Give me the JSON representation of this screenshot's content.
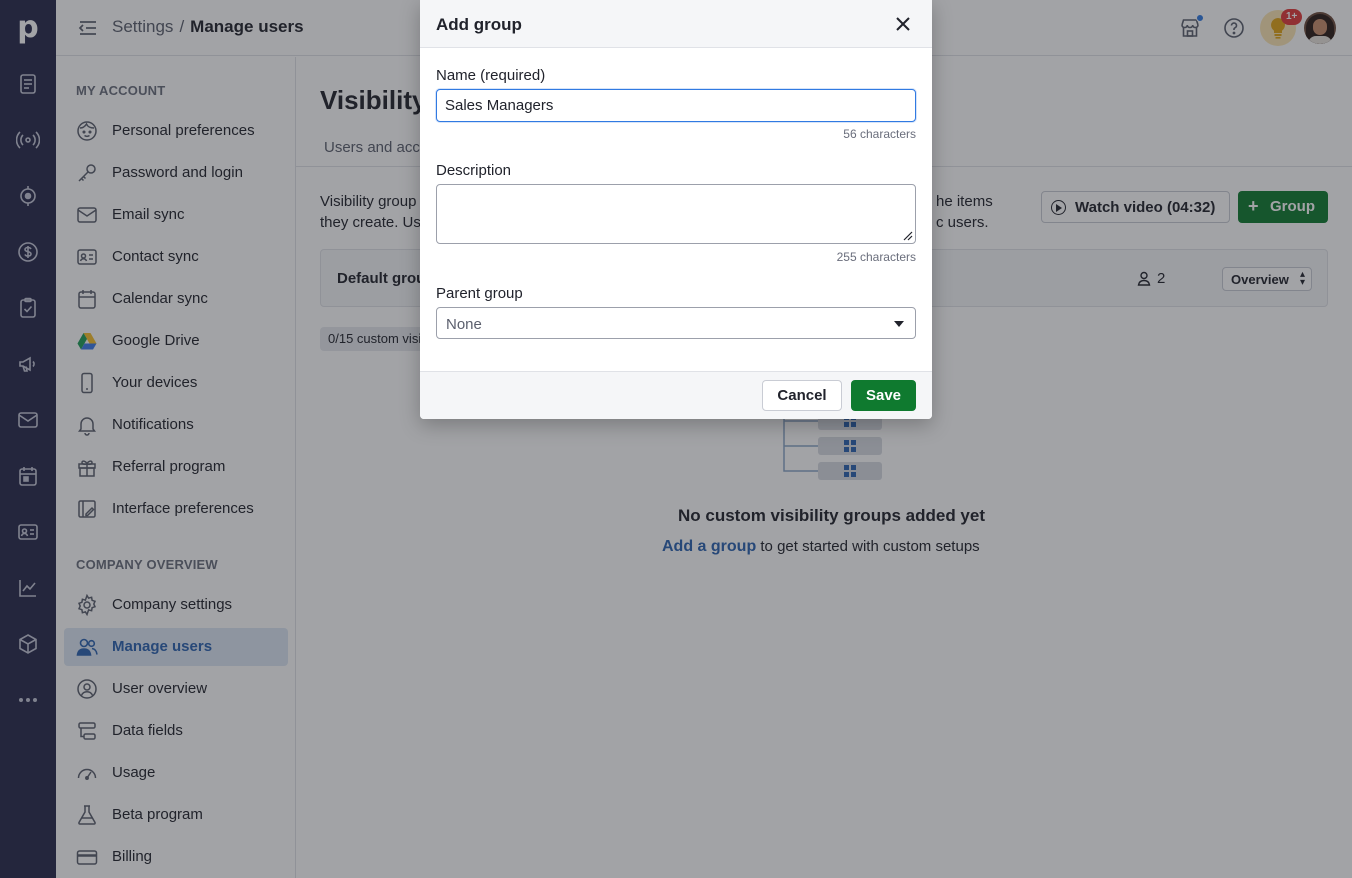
{
  "rail": {
    "logo": "p",
    "items": [
      "deals-icon",
      "leads-icon",
      "projects-icon",
      "money-icon",
      "tasks-icon",
      "campaigns-icon",
      "mail-icon",
      "calendar-icon",
      "contacts-icon",
      "insights-icon",
      "products-icon",
      "more-icon"
    ]
  },
  "topbar": {
    "breadcrumb_root": "Settings",
    "breadcrumb_sep": "/",
    "breadcrumb_current": "Manage users",
    "notification_count": "1+"
  },
  "sidebar": {
    "my_account_title": "MY ACCOUNT",
    "my_account": [
      {
        "label": "Personal preferences",
        "icon": "face-icon"
      },
      {
        "label": "Password and login",
        "icon": "key-icon"
      },
      {
        "label": "Email sync",
        "icon": "envelope-icon"
      },
      {
        "label": "Contact sync",
        "icon": "contact-card-icon"
      },
      {
        "label": "Calendar sync",
        "icon": "calendar-icon"
      },
      {
        "label": "Google Drive",
        "icon": "google-drive-icon"
      },
      {
        "label": "Your devices",
        "icon": "phone-icon"
      },
      {
        "label": "Notifications",
        "icon": "bell-icon"
      },
      {
        "label": "Referral program",
        "icon": "gift-icon"
      },
      {
        "label": "Interface preferences",
        "icon": "interface-icon"
      }
    ],
    "company_title": "COMPANY OVERVIEW",
    "company": [
      {
        "label": "Company settings",
        "icon": "gear-icon"
      },
      {
        "label": "Manage users",
        "icon": "users-icon",
        "active": true
      },
      {
        "label": "User overview",
        "icon": "user-circle-icon"
      },
      {
        "label": "Data fields",
        "icon": "data-fields-icon"
      },
      {
        "label": "Usage",
        "icon": "gauge-icon"
      },
      {
        "label": "Beta program",
        "icon": "flask-icon"
      },
      {
        "label": "Billing",
        "icon": "credit-card-icon"
      }
    ]
  },
  "main": {
    "title": "Visibility",
    "tab": "Users and acc",
    "intro_line1": "Visibility group",
    "intro_line2": "they create. Us",
    "intro_right1": "he items",
    "intro_right2": "c users.",
    "watch_video": "Watch video (04:32)",
    "add_group_btn": "Group",
    "default_group": "Default grou",
    "user_count": "2",
    "overview_select": "Overview",
    "limit_chip": "0/15 custom visi",
    "empty_title": "No custom visibility groups added yet",
    "empty_link": "Add a group",
    "empty_rest": " to get started with custom setups"
  },
  "modal": {
    "title": "Add group",
    "name_label": "Name (required)",
    "name_value": "Sales Managers",
    "name_count": "56 characters",
    "description_label": "Description",
    "description_value": "",
    "description_count": "255 characters",
    "parent_label": "Parent group",
    "parent_value": "None",
    "cancel": "Cancel",
    "save": "Save"
  },
  "colors": {
    "rail": "#26294a",
    "accent_blue": "#317ae2",
    "save_green": "#0f7a2f",
    "active_nav_bg": "#dde7f4"
  }
}
